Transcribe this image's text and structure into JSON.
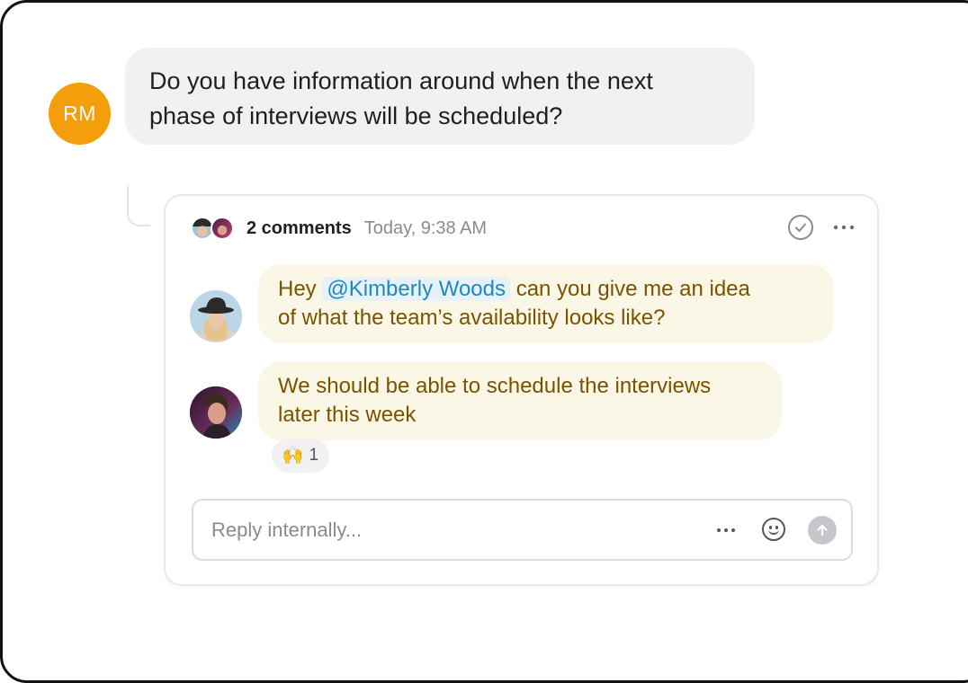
{
  "question": {
    "avatar_initials": "RM",
    "avatar_color": "#f59e0b",
    "text_line1": "Do you have information around when the next",
    "text_line2": "phase of interviews will be scheduled?"
  },
  "thread": {
    "comment_count": "2 comments",
    "timestamp": "Today, 9:38 AM",
    "icons": {
      "resolve": "check-circle-icon",
      "more": "more-horizontal-icon"
    },
    "comments": [
      {
        "prefix": "Hey",
        "mention": "@Kimberly Woods",
        "suffix": "can you give me an idea",
        "line2": "of what the team’s availability looks like?"
      },
      {
        "line1": "We should be able to schedule the interviews",
        "line2": "later this week",
        "reaction": {
          "emoji": "🙌",
          "count": "1"
        }
      }
    ]
  },
  "reply": {
    "placeholder": "Reply internally...",
    "value": "",
    "icons": {
      "more": "more-horizontal-icon",
      "emoji": "smiley-icon",
      "send": "send-arrow-icon"
    }
  },
  "colors": {
    "bubble_bg": "#fbf7e6",
    "bubble_text": "#7a5200",
    "mention_text": "#1c8ac2",
    "mention_bg": "#e7f1f6"
  }
}
